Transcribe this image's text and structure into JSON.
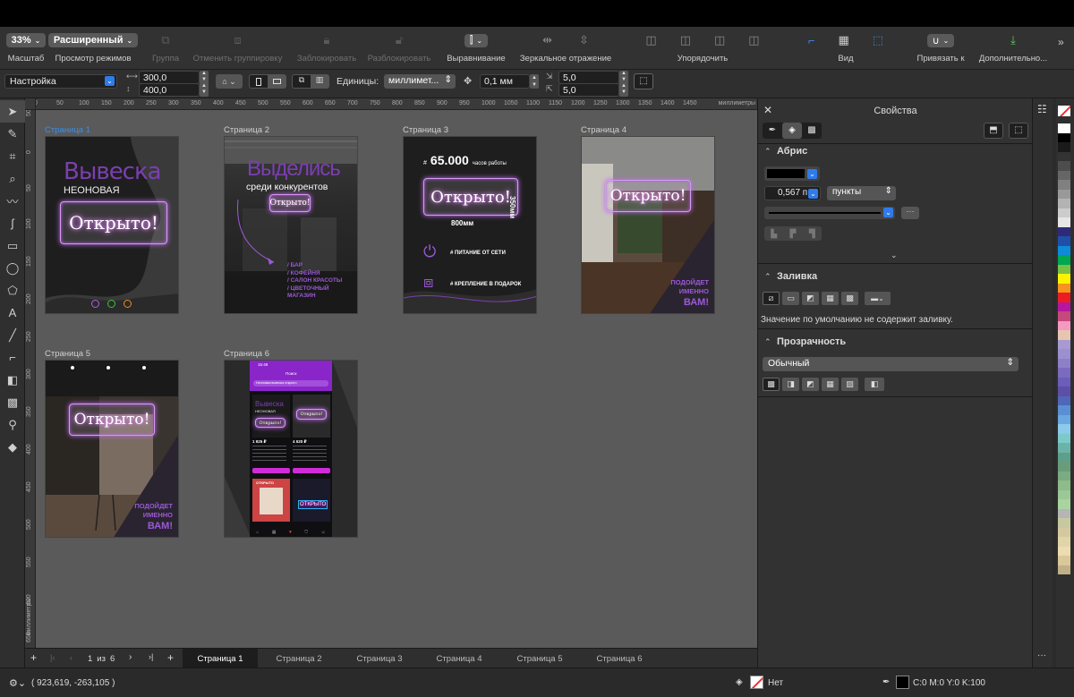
{
  "toolbar": {
    "zoom_value": "33%",
    "zoom_label": "Масштаб",
    "view_mode_value": "Расширенный",
    "view_mode_label": "Просмотр режимов",
    "group_label": "Группа",
    "ungroup_label": "Отменить группировку",
    "lock_label": "Заблокировать",
    "unlock_label": "Разблокировать",
    "align_label": "Выравнивание",
    "mirror_label": "Зеркальное отражение",
    "arrange_label": "Упорядочить",
    "view_label": "Вид",
    "snap_label": "Привязать к",
    "more_label": "Дополнительно..."
  },
  "propbar": {
    "preset_value": "Настройка",
    "width_value": "300,0",
    "height_value": "400,0",
    "units_label": "Единицы:",
    "units_value": "миллимет...",
    "nudge_value": "0,1 мм",
    "dup_x_value": "5,0",
    "dup_y_value": "5,0"
  },
  "ruler": {
    "h_ticks": [
      "0",
      "50",
      "100",
      "150",
      "200",
      "250",
      "300",
      "350",
      "400",
      "450",
      "500",
      "550",
      "600",
      "650",
      "700",
      "750",
      "800",
      "850",
      "900",
      "950",
      "1000",
      "1050",
      "1100",
      "1150",
      "1200",
      "1250",
      "1300",
      "1350",
      "1400",
      "1450"
    ],
    "h_unit": "миллиметры",
    "v_ticks": [
      "50",
      "0",
      "50",
      "100",
      "150",
      "200",
      "250",
      "300",
      "350",
      "400",
      "450",
      "500",
      "550",
      "600",
      "650"
    ],
    "v_unit": "миллиметры"
  },
  "pages": [
    {
      "label": "Страница 1",
      "title": "Вывеска",
      "subtitle": "НЕОНОВАЯ",
      "neon": "Открыто!"
    },
    {
      "label": "Страница 2",
      "title": "Выделись",
      "subtitle": "среди конкурентов",
      "neon": "Открыто!",
      "list": [
        "/ БАР",
        "/ КОФЕЙНЯ",
        "/ САЛОН КРАСОТЫ",
        "/ ЦВЕТОЧНЫЙ МАГАЗИН"
      ]
    },
    {
      "label": "Страница 3",
      "hash1": "#",
      "hours_value": "65.000",
      "hours_label": "часов работы",
      "neon": "Открыто!",
      "dim_h": "350мм",
      "dim_w": "800мм",
      "feature1": "# ПИТАНИЕ ОТ СЕТИ",
      "feature2": "# КРЕПЛЕНИЕ В ПОДАРОК"
    },
    {
      "label": "Страница 4",
      "neon": "Открыто!",
      "tagline1": "ПОДОЙДЕТ",
      "tagline2": "ИМЕННО",
      "tagline3": "ВАМ!"
    },
    {
      "label": "Страница 5",
      "neon": "Открыто!",
      "tagline1": "ПОДОЙДЕТ",
      "tagline2": "ИМЕННО",
      "tagline3": "ВАМ!"
    },
    {
      "label": "Страница 6",
      "status_time": "15:48",
      "search_title": "Поиск",
      "search_query": "Неоновая вывеска открыто",
      "card1_title": "Вывеска",
      "card1_sub": "НЕОНОВАЯ",
      "card1_neon": "Открыто!",
      "card2_neon": "Открыто!",
      "card3_neon": "ОТКРЫТО",
      "card4_neon": "ОТКРЫТО",
      "price1": "1 925 ₽",
      "price2": "4 520 ₽"
    }
  ],
  "pagetabs": {
    "current": "1",
    "of": "из",
    "total": "6",
    "tabs": [
      "Страница 1",
      "Страница 2",
      "Страница 3",
      "Страница 4",
      "Страница 5",
      "Страница 6"
    ]
  },
  "status": {
    "coords": "( 923,619, -263,105 )",
    "fill_label": "Нет",
    "outline_value": "C:0 M:0 Y:0 K:100"
  },
  "panel": {
    "title": "Свойства",
    "outline_section": "Абрис",
    "outline_width": "0,567 п",
    "outline_units": "пункты",
    "fill_section": "Заливка",
    "fill_note": "Значение по умолчанию не содержит заливку.",
    "transparency_section": "Прозрачность",
    "transparency_mode": "Обычный"
  },
  "palette_colors": [
    "#ffffff",
    "#000000",
    "#1a1a1a",
    "#333333",
    "#4d4d4d",
    "#666666",
    "#808080",
    "#999999",
    "#b3b3b3",
    "#cccccc",
    "#e6e6e6",
    "#2e2a7a",
    "#1f4fa8",
    "#0d8bd9",
    "#00a650",
    "#7ac143",
    "#fff200",
    "#f7941d",
    "#ed1c24",
    "#b5179e",
    "#c5497d",
    "#f49ac1",
    "#e8c5b0",
    "#a79ad2",
    "#9b8fd0",
    "#8e7fc8",
    "#7a6bbf",
    "#6b5db8",
    "#5d4fa8",
    "#4f67b8",
    "#5b8fd4",
    "#6ba7e0",
    "#8cc9ea",
    "#7cc9c9",
    "#6bb3a8",
    "#5d9f8a",
    "#6b9c7a",
    "#7bab82",
    "#8dbb8a",
    "#9bc896",
    "#a8d4a0",
    "#b5b5b5",
    "#c8c8a0",
    "#d4c8a0",
    "#e0d4a8",
    "#ecdcb0",
    "#d8c89a",
    "#c0b088"
  ]
}
